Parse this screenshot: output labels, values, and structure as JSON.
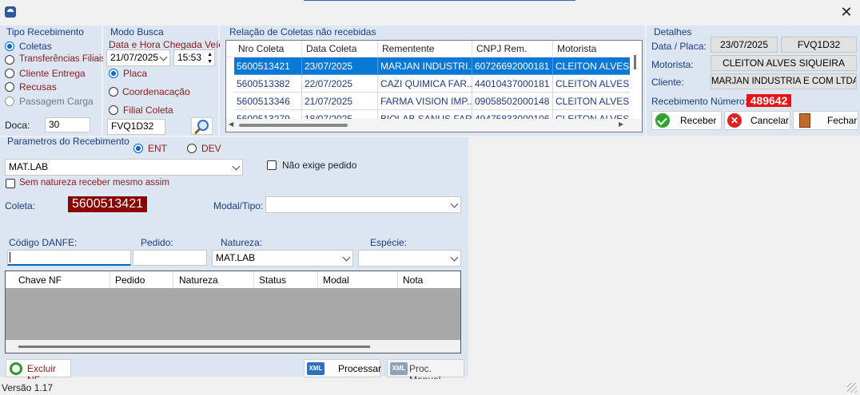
{
  "window": {
    "close_glyph": "✕",
    "icon": "app-logo-icon"
  },
  "tipo_recebimento": {
    "title": "Tipo Recebimento",
    "options": [
      "Coletas",
      "Transferências Filiais",
      "Cliente Entrega",
      "Recusas",
      "Passagem Carga"
    ],
    "selected": "Coletas",
    "doca_label": "Doca:",
    "doca_value": "30"
  },
  "modo_busca": {
    "title": "Modo Busca",
    "datetime_label": "Data e Hora Chegada Veíc.",
    "date_value": "21/07/2025",
    "time_value": "15:53",
    "options": [
      "Placa",
      "Coordenacação",
      "Filial Coleta"
    ],
    "selected": "Placa",
    "search_value": "FVQ1D32"
  },
  "relacao": {
    "title": "Relação de Coletas não recebidas",
    "columns": [
      "Nro Coleta",
      "Data Coleta",
      "Rementente",
      "CNPJ Rem.",
      "Motorista"
    ],
    "rows": [
      [
        "5600513421",
        "23/07/2025",
        "MARJAN INDUSTRI...",
        "60726692000181",
        "CLEITON ALVES S"
      ],
      [
        "5600513382",
        "22/07/2025",
        "CAZI QUIMICA FAR...",
        "44010437000181",
        "CLEITON ALVES S"
      ],
      [
        "5600513346",
        "21/07/2025",
        "FARMA VISION IMP...",
        "09058502000148",
        "CLEITON ALVES S"
      ],
      [
        "5600513279",
        "18/07/2025",
        "BIOLAB SANUS FAR...",
        "49475833000106",
        "CLEITON ALVES S"
      ]
    ],
    "selected_row": 0
  },
  "detalhes": {
    "title": "Detalhes",
    "data_placa_label": "Data / Placa:",
    "data_value": "23/07/2025",
    "placa_value": "FVQ1D32",
    "motorista_label": "Motorista:",
    "motorista_value": "CLEITON ALVES SIQUEIRA",
    "cliente_label": "Cliente:",
    "cliente_value": "MARJAN INDUSTRIA E COM LTDA",
    "recebimento_label": "Recebimento Número:",
    "recebimento_value": "489642",
    "btn_receber": "Receber",
    "btn_cancelar": "Cancelar",
    "btn_fechar": "Fechar"
  },
  "parametros": {
    "title": "Parametros do Recebimento",
    "ent_label": "ENT",
    "dev_label": "DEV",
    "selected": "ENT",
    "natureza_combo": "MAT.LAB",
    "nao_exige_label": "Não exige pedido",
    "sem_natureza_label": "Sem natureza receber mesmo assim",
    "coleta_label": "Coleta:",
    "coleta_value": "5600513421",
    "modal_label": "Modal/Tipo:",
    "modal_value": "",
    "codigo_danfe_label": "Código DANFE:",
    "codigo_danfe_value": "",
    "pedido_label": "Pedido:",
    "pedido_value": "",
    "natureza_label": "Natureza:",
    "natureza_value": "MAT.LAB",
    "especie_label": "Espécie:",
    "especie_value": "",
    "nf_columns": [
      "Chave NF",
      "Pedido",
      "Natureza",
      "Status",
      "Modal",
      "Nota"
    ],
    "btn_excluir": "Excluir NF",
    "btn_processar": "Processar",
    "btn_proc_manual": "Proc. Manual"
  },
  "status_bar": {
    "version": "Versão 1.17"
  }
}
